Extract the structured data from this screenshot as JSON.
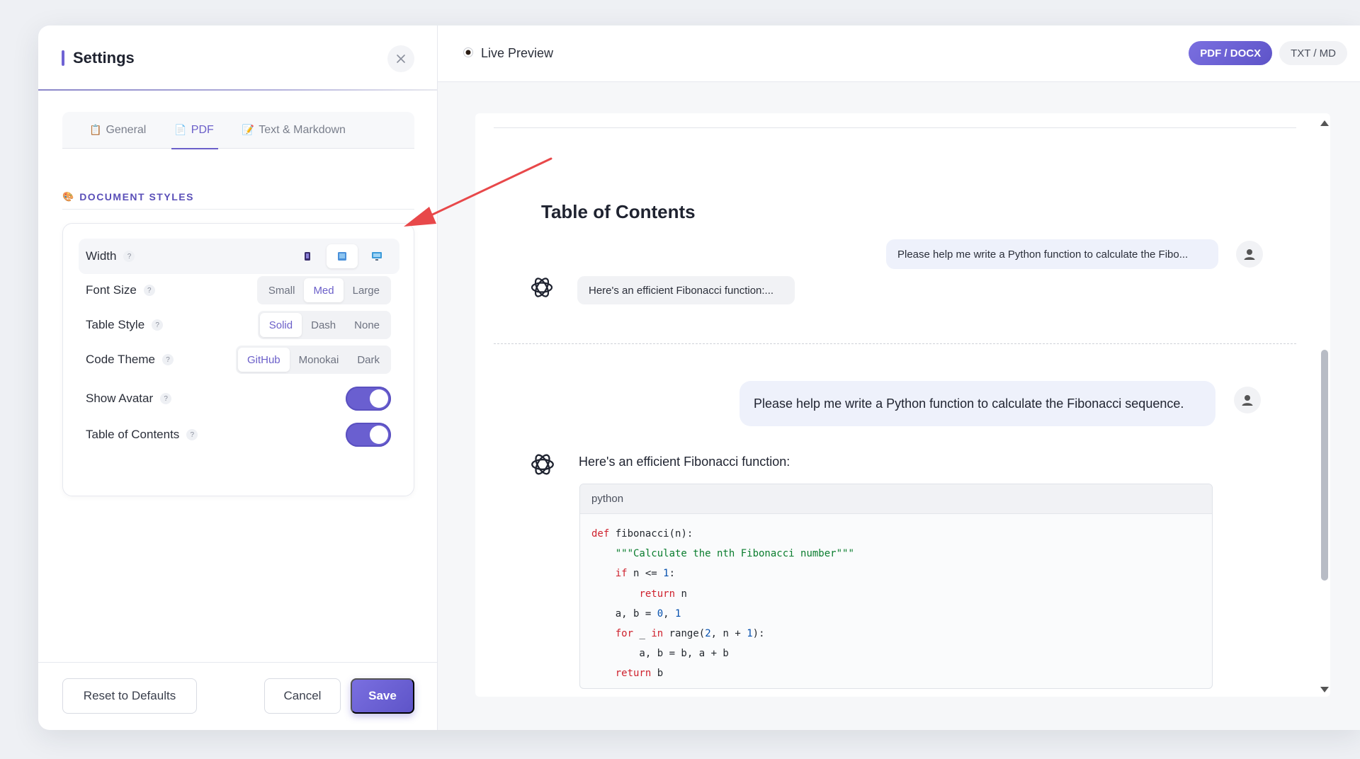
{
  "settings": {
    "title": "Settings",
    "tabs": [
      {
        "label": "General",
        "icon": "clipboard-icon"
      },
      {
        "label": "PDF",
        "icon": "document-icon"
      },
      {
        "label": "Text & Markdown",
        "icon": "pencil-icon"
      }
    ],
    "active_tab": "PDF",
    "section_title": "DOCUMENT STYLES",
    "rows": {
      "width": {
        "label": "Width",
        "help": "?"
      },
      "font_size": {
        "label": "Font Size",
        "help": "?",
        "options": [
          "Small",
          "Med",
          "Large"
        ],
        "selected": "Med"
      },
      "table_style": {
        "label": "Table Style",
        "help": "?",
        "options": [
          "Solid",
          "Dash",
          "None"
        ],
        "selected": "Solid"
      },
      "code_theme": {
        "label": "Code Theme",
        "help": "?",
        "options": [
          "GitHub",
          "Monokai",
          "Dark"
        ],
        "selected": "GitHub"
      },
      "show_avatar": {
        "label": "Show Avatar",
        "help": "?",
        "enabled": true
      },
      "toc": {
        "label": "Table of Contents",
        "help": "?",
        "enabled": true
      }
    },
    "footer": {
      "reset": "Reset to Defaults",
      "cancel": "Cancel",
      "save": "Save"
    }
  },
  "preview": {
    "title": "Live Preview",
    "formats": [
      "PDF / DOCX",
      "TXT / MD"
    ],
    "active_format": "PDF / DOCX",
    "doc": {
      "toc_title": "Table of Contents",
      "toc_user": "Please help me write a Python function to calculate the Fibo...",
      "toc_ai": "Here's an efficient Fibonacci function:...",
      "user_message": "Please help me write a Python function to calculate the Fibonacci sequence.",
      "ai_message": "Here's an efficient Fibonacci function:",
      "code_lang": "python"
    }
  },
  "colors": {
    "accent": "#6b5fc9",
    "toggle": "#6a5fd0",
    "arrow": "#e8484a"
  }
}
